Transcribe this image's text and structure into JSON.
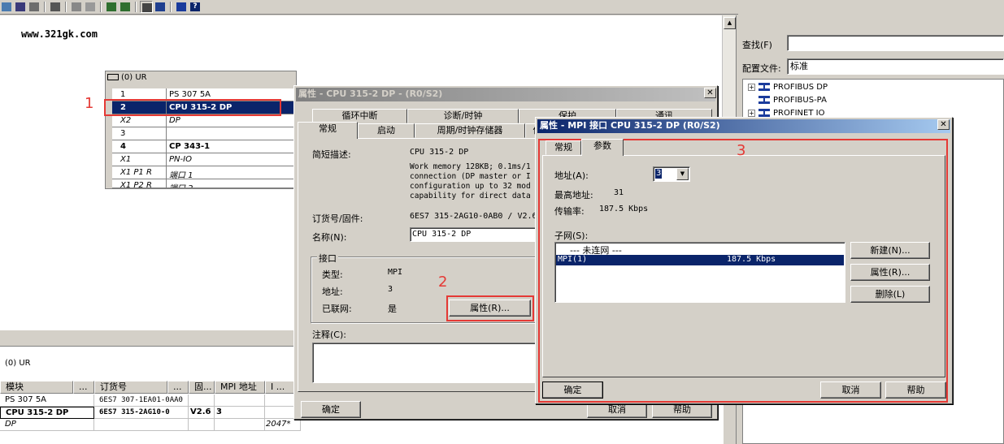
{
  "website": "www.321gk.com",
  "rack": {
    "title": "(0) UR",
    "rows": [
      {
        "slot": "1",
        "module": "PS 307 5A"
      },
      {
        "slot": "2",
        "module": "CPU 315-2 DP"
      },
      {
        "slot": "X2",
        "module": "DP"
      },
      {
        "slot": "3",
        "module": ""
      },
      {
        "slot": "4",
        "module": "CP 343-1"
      },
      {
        "slot": "X1",
        "module": "PN-IO"
      },
      {
        "slot": "X1 P1 R",
        "module": "端口 1"
      },
      {
        "slot": "X1 P2 R",
        "module": "端口 2"
      }
    ]
  },
  "annotations": {
    "one": "1",
    "two": "2",
    "three": "3"
  },
  "bottom": {
    "title": "(0)   UR",
    "headers": [
      "模块",
      "...",
      "订货号",
      "...",
      "固...",
      "MPI 地址",
      "I ..."
    ],
    "rows": [
      {
        "module": "PS 307 5A",
        "order": "6ES7 307-1EA01-0AA0",
        "fw": "",
        "mpi": "",
        "i": ""
      },
      {
        "module": "CPU 315-2 DP",
        "order": "6ES7 315-2AG10-0",
        "fw": "V2.6",
        "mpi": "3",
        "i": ""
      },
      {
        "module": "DP",
        "order": "",
        "fw": "",
        "mpi": "",
        "i": "2047*"
      }
    ]
  },
  "catalog": {
    "search_label": "查找(F)",
    "search_value": "",
    "profile_label": "配置文件:",
    "profile_value": "标准",
    "tree": [
      "PROFIBUS DP",
      "PROFIBUS-PA",
      "PROFINET IO"
    ]
  },
  "cpu_dialog": {
    "title": "属性 - CPU 315-2 DP - (R0/S2)",
    "tabs_row1": [
      "循环中断",
      "诊断/时钟",
      "保护",
      "通讯"
    ],
    "tabs_row2": [
      "常规",
      "启动",
      "周期/时钟存储器",
      "保"
    ],
    "desc_label": "简短描述:",
    "desc_value": "CPU 315-2 DP",
    "desc_text": [
      "Work memory 128KB; 0.1ms/1",
      "connection (DP master or I",
      "configuration up to 32 mod",
      "capability for direct data"
    ],
    "order_label": "订货号/固件:",
    "order_value": "6ES7 315-2AG10-0AB0 / V2.6",
    "name_label": "名称(N):",
    "name_value": "CPU 315-2 DP",
    "interface_group": "接口",
    "type_label": "类型:",
    "type_value": "MPI",
    "addr_label": "地址:",
    "addr_value": "3",
    "networked_label": "已联网:",
    "networked_value": "是",
    "props_button": "属性(R)...",
    "comment_label": "注释(C):",
    "ok": "确定",
    "cancel": "取消",
    "help": "帮助"
  },
  "mpi_dialog": {
    "title": "属性 - MPI 接口  CPU 315-2 DP (R0/S2)",
    "tabs": [
      "常规",
      "参数"
    ],
    "address_label": "地址(A):",
    "address_value": "3",
    "max_label": "最高地址:",
    "max_value": "31",
    "rate_label": "传输率:",
    "rate_value": "187.5 Kbps",
    "subnet_label": "子网(S):",
    "subnets": [
      {
        "name": "--- 未连网 ---",
        "rate": ""
      },
      {
        "name": "MPI(1)",
        "rate": "187.5 Kbps"
      }
    ],
    "new_button": "新建(N)...",
    "props_button": "属性(R)...",
    "delete_button": "删除(L)",
    "ok": "确定",
    "cancel": "取消",
    "help": "帮助"
  }
}
